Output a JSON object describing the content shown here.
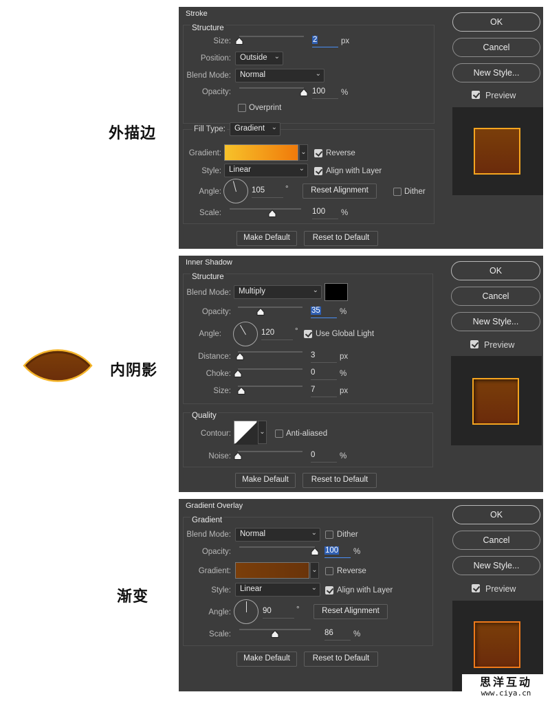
{
  "annotations": {
    "stroke": "外描边",
    "inner_shadow": "内阴影",
    "gradient_overlay": "渐变"
  },
  "watermark": {
    "line1": "思洋互动",
    "line2": "www.ciya.cn"
  },
  "colors": {
    "dialog_bg": "#3c3c3c",
    "accent_blue": "#2f5fb3",
    "stroke_gradient": [
      "#f7c22a",
      "#f07a0a"
    ],
    "overlay_gradient": [
      "#7a3e0a",
      "#6a340a"
    ],
    "shadow_color": "#000000",
    "preview_inner": "#6f330b",
    "preview_border": "#f39020"
  },
  "buttons": {
    "ok": "OK",
    "cancel": "Cancel",
    "new_style": "New Style...",
    "preview": "Preview",
    "make_default": "Make Default",
    "reset_default": "Reset to Default"
  },
  "stroke": {
    "title": "Stroke",
    "structure": "Structure",
    "size_label": "Size:",
    "size": "2",
    "size_unit": "px",
    "size_pct": 0,
    "position_label": "Position:",
    "position": "Outside",
    "blend_label": "Blend Mode:",
    "blend": "Normal",
    "opacity_label": "Opacity:",
    "opacity": "100",
    "opacity_unit": "%",
    "opacity_pct": 100,
    "overprint": "Overprint",
    "fill_type_label": "Fill Type:",
    "fill_type": "Gradient",
    "gradient_label": "Gradient:",
    "reverse": "Reverse",
    "style_label": "Style:",
    "style": "Linear",
    "align": "Align with Layer",
    "angle_label": "Angle:",
    "angle": "105",
    "angle_unit": "°",
    "reset_alignment": "Reset Alignment",
    "dither": "Dither",
    "scale_label": "Scale:",
    "scale": "100",
    "scale_unit": "%",
    "scale_pct": 60
  },
  "inner": {
    "title": "Inner Shadow",
    "structure": "Structure",
    "blend_label": "Blend Mode:",
    "blend": "Multiply",
    "opacity_label": "Opacity:",
    "opacity": "35",
    "opacity_unit": "%",
    "opacity_pct": 35,
    "angle_label": "Angle:",
    "angle": "120",
    "angle_unit": "°",
    "global_light": "Use Global Light",
    "distance_label": "Distance:",
    "distance": "3",
    "distance_unit": "px",
    "distance_pct": 3,
    "choke_label": "Choke:",
    "choke": "0",
    "choke_unit": "%",
    "choke_pct": 0,
    "size_label": "Size:",
    "size": "7",
    "size_unit": "px",
    "size_pct": 5,
    "quality": "Quality",
    "contour_label": "Contour:",
    "anti_aliased": "Anti-aliased",
    "noise_label": "Noise:",
    "noise": "0",
    "noise_unit": "%",
    "noise_pct": 0
  },
  "overlay": {
    "title": "Gradient Overlay",
    "gradient_group": "Gradient",
    "blend_label": "Blend Mode:",
    "blend": "Normal",
    "dither": "Dither",
    "opacity_label": "Opacity:",
    "opacity": "100",
    "opacity_unit": "%",
    "opacity_pct": 100,
    "gradient_label": "Gradient:",
    "reverse": "Reverse",
    "style_label": "Style:",
    "style": "Linear",
    "align": "Align with Layer",
    "angle_label": "Angle:",
    "angle": "90",
    "angle_unit": "°",
    "reset_alignment": "Reset Alignment",
    "scale_label": "Scale:",
    "scale": "86",
    "scale_unit": "%",
    "scale_pct": 50
  }
}
